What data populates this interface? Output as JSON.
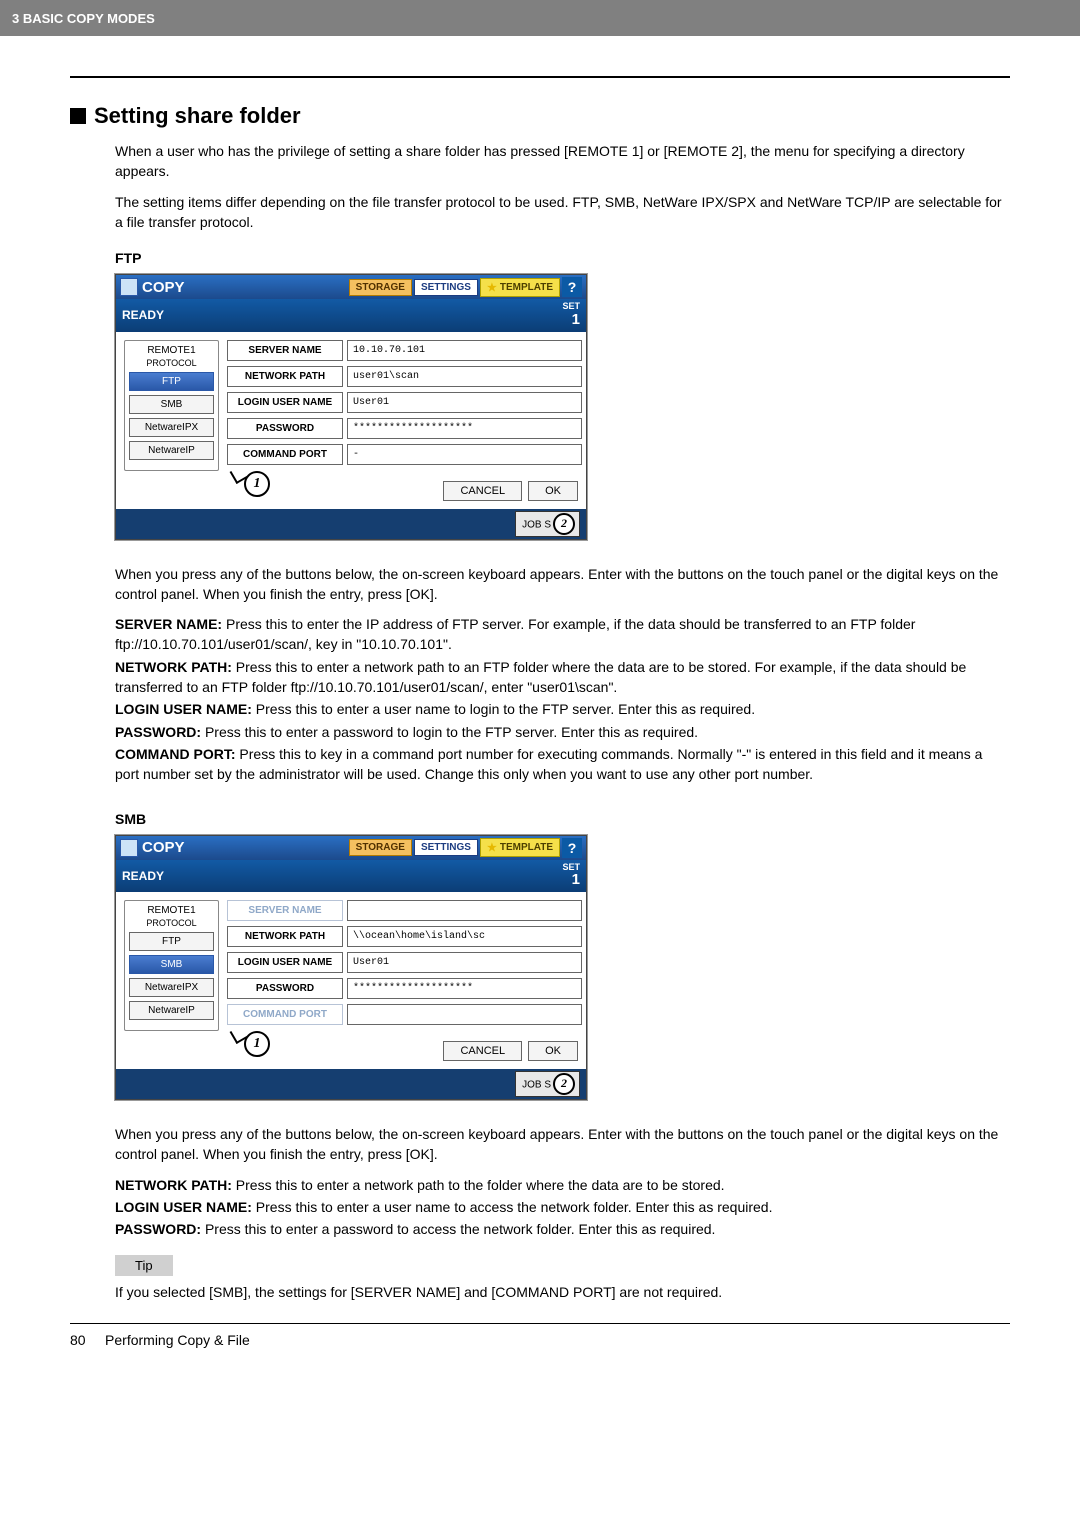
{
  "header": {
    "chapter": "3 BASIC COPY MODES"
  },
  "section": {
    "title": "Setting share folder"
  },
  "intro": {
    "p1": "When a user who has the privilege of setting a share folder has pressed [REMOTE 1] or [REMOTE 2], the menu for specifying a directory appears.",
    "p2": "The setting items differ depending on the file transfer protocol to be used. FTP, SMB, NetWare IPX/SPX and NetWare TCP/IP are selectable for a file transfer protocol."
  },
  "ftp": {
    "heading": "FTP",
    "shot": {
      "title": "COPY",
      "btn_storage": "STORAGE",
      "btn_settings": "SETTINGS",
      "btn_template": "TEMPLATE",
      "help": "?",
      "ready": "READY",
      "set_label": "SET",
      "set_count": "1",
      "remote_label": "REMOTE1",
      "protocol_label": "PROTOCOL",
      "protocols": {
        "ftp": "FTP",
        "smb": "SMB",
        "nipx": "NetwareIPX",
        "nip": "NetwareIP"
      },
      "fields": {
        "server_name_lbl": "SERVER NAME",
        "server_name_val": "10.10.70.101",
        "network_path_lbl": "NETWORK PATH",
        "network_path_val": "user01\\scan",
        "login_lbl": "LOGIN USER NAME",
        "login_val": "User01",
        "password_lbl": "PASSWORD",
        "password_val": "********************",
        "cmdport_lbl": "COMMAND PORT",
        "cmdport_val": "-"
      },
      "cancel": "CANCEL",
      "ok": "OK",
      "jobstatus": "JOB STATUS"
    },
    "after": "When you press any of the buttons below, the on-screen keyboard appears. Enter with the buttons on the touch panel or the digital keys on the control panel. When you finish the entry, press [OK].",
    "desc": {
      "server_name_k": "SERVER NAME:",
      "server_name_v": " Press this to enter the IP address of FTP server. For example, if the data should be transferred to an FTP folder ftp://10.10.70.101/user01/scan/, key in \"10.10.70.101\".",
      "network_path_k": "NETWORK PATH:",
      "network_path_v": " Press this to enter a network path to an FTP folder where the data are to be stored. For example, if the data should be transferred to an FTP folder ftp://10.10.70.101/user01/scan/, enter \"user01\\scan\".",
      "login_k": "LOGIN USER NAME:",
      "login_v": " Press this to enter a user name to login to the FTP server. Enter this as required.",
      "password_k": "PASSWORD:",
      "password_v": " Press this to enter a password to login to the FTP server. Enter this as required.",
      "cmdport_k": "COMMAND PORT:",
      "cmdport_v": " Press this to key in a command port number for executing commands. Normally \"-\" is entered in this field and it means a port number set by the administrator will be used. Change this only when you want to use any other port number."
    }
  },
  "smb": {
    "heading": "SMB",
    "shot": {
      "title": "COPY",
      "btn_storage": "STORAGE",
      "btn_settings": "SETTINGS",
      "btn_template": "TEMPLATE",
      "help": "?",
      "ready": "READY",
      "set_label": "SET",
      "set_count": "1",
      "remote_label": "REMOTE1",
      "protocol_label": "PROTOCOL",
      "protocols": {
        "ftp": "FTP",
        "smb": "SMB",
        "nipx": "NetwareIPX",
        "nip": "NetwareIP"
      },
      "fields": {
        "server_name_lbl": "SERVER NAME",
        "server_name_val": "",
        "network_path_lbl": "NETWORK PATH",
        "network_path_val": "\\\\ocean\\home\\island\\sc",
        "login_lbl": "LOGIN USER NAME",
        "login_val": "User01",
        "password_lbl": "PASSWORD",
        "password_val": "********************",
        "cmdport_lbl": "COMMAND PORT",
        "cmdport_val": ""
      },
      "cancel": "CANCEL",
      "ok": "OK",
      "jobstatus": "JOB STATUS"
    },
    "after": "When you press any of the buttons below, the on-screen keyboard appears. Enter with the buttons on the touch panel or the digital keys on the control panel. When you finish the entry, press [OK].",
    "desc": {
      "network_path_k": "NETWORK PATH:",
      "network_path_v": " Press this to enter a network path to the folder where the data are to be stored.",
      "login_k": "LOGIN USER NAME:",
      "login_v": " Press this to enter a user name to access the network folder. Enter this as required.",
      "password_k": "PASSWORD:",
      "password_v": " Press this to enter a password to access the network folder. Enter this as required."
    },
    "tip_label": "Tip",
    "tip_text": "If you selected [SMB], the settings for [SERVER NAME] and [COMMAND PORT] are not required."
  },
  "callouts": {
    "one": "1",
    "two": "2"
  },
  "footer": {
    "page": "80",
    "title": "Performing Copy & File"
  }
}
